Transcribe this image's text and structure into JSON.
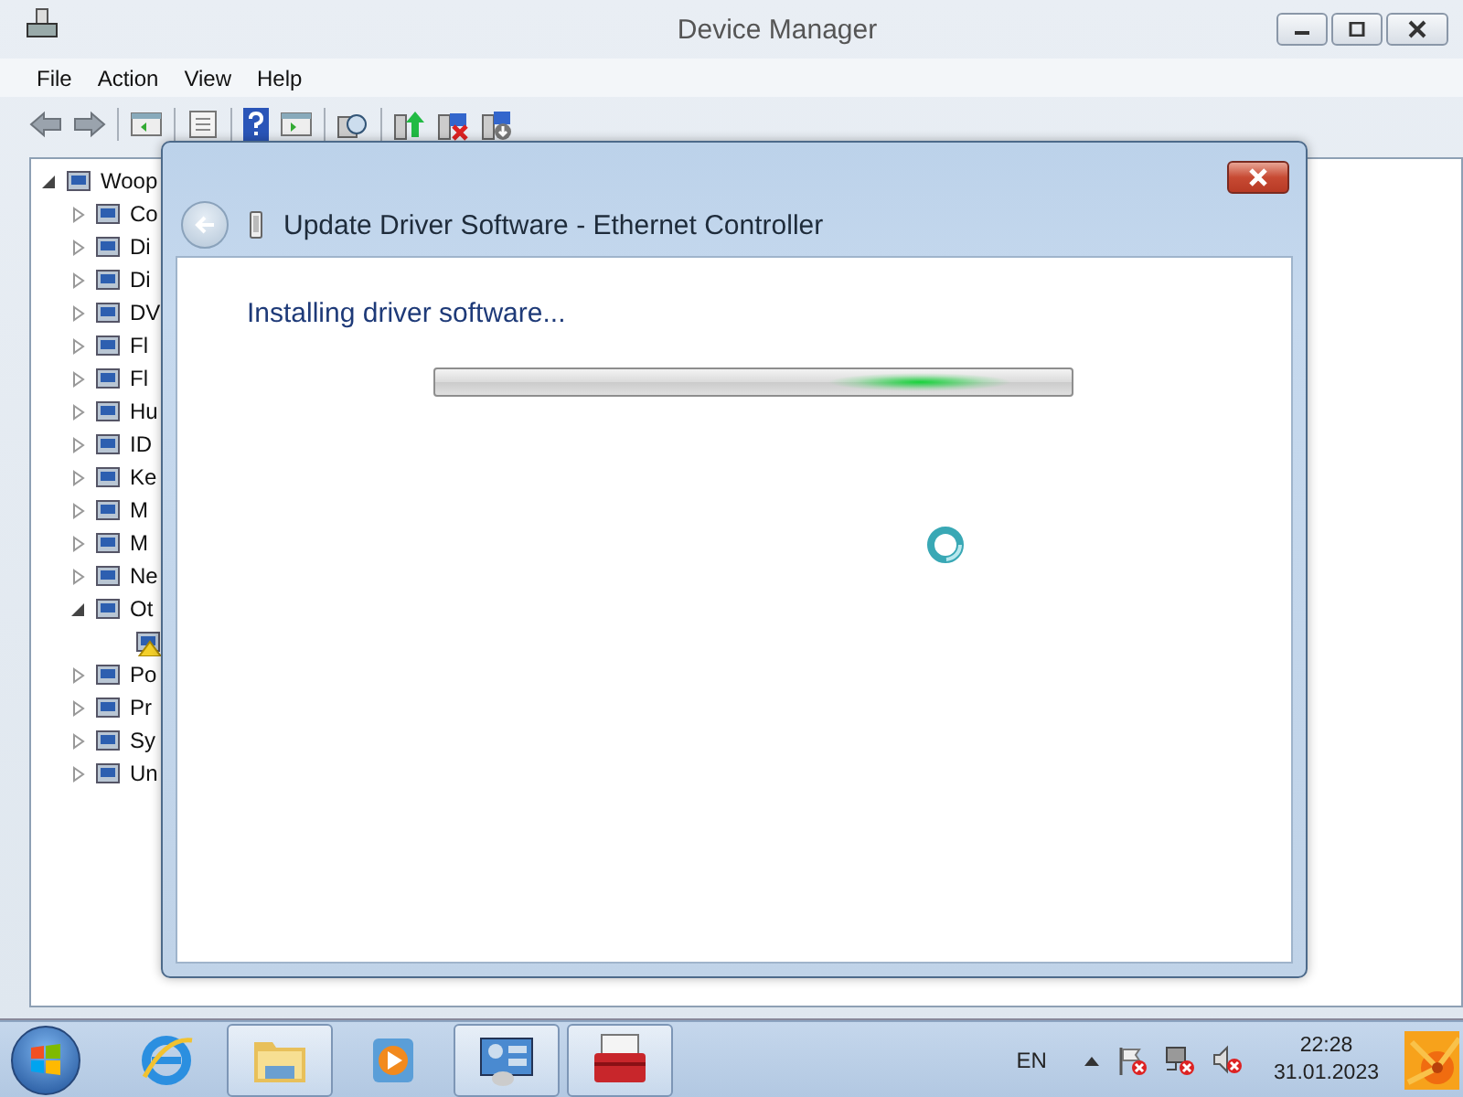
{
  "window": {
    "title": "Device Manager"
  },
  "menu": [
    "File",
    "Action",
    "View",
    "Help"
  ],
  "tree": {
    "label": "Woop",
    "expanded": true,
    "children": [
      {
        "label": "Co",
        "expanded": false
      },
      {
        "label": "Di",
        "expanded": false
      },
      {
        "label": "Di",
        "expanded": false
      },
      {
        "label": "DV",
        "expanded": false
      },
      {
        "label": "Fl",
        "expanded": false
      },
      {
        "label": "Fl",
        "expanded": false
      },
      {
        "label": "Hu",
        "expanded": false
      },
      {
        "label": "ID",
        "expanded": false
      },
      {
        "label": "Ke",
        "expanded": false
      },
      {
        "label": "M",
        "expanded": false
      },
      {
        "label": "M",
        "expanded": false
      },
      {
        "label": "Ne",
        "expanded": false
      },
      {
        "label": "Ot",
        "expanded": true,
        "children": [
          {
            "warning": true
          }
        ]
      },
      {
        "label": "Po",
        "expanded": false
      },
      {
        "label": "Pr",
        "expanded": false
      },
      {
        "label": "Sy",
        "expanded": false
      },
      {
        "label": "Un",
        "expanded": false
      }
    ]
  },
  "dialog": {
    "title": "Update Driver Software - Ethernet Controller",
    "message": "Installing driver software...",
    "progress": {
      "indeterminate": true
    }
  },
  "taskbar": {
    "apps": [
      {
        "kind": "ie",
        "running": false
      },
      {
        "kind": "explorer",
        "running": true
      },
      {
        "kind": "media",
        "running": false
      },
      {
        "kind": "panel",
        "running": true
      },
      {
        "kind": "toolbox",
        "running": true
      }
    ],
    "language": "EN",
    "time": "22:28",
    "date": "31.01.2023"
  }
}
